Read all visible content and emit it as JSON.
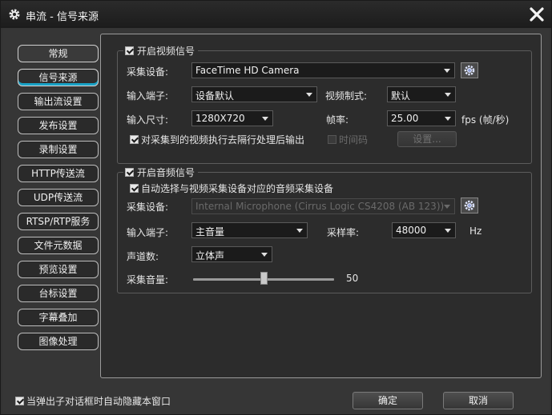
{
  "window": {
    "title": "串流 - 信号来源"
  },
  "nav": {
    "items": [
      {
        "label": "常规"
      },
      {
        "label": "信号来源"
      },
      {
        "label": "输出流设置"
      },
      {
        "label": "发布设置"
      },
      {
        "label": "录制设置"
      },
      {
        "label": "HTTP传送流"
      },
      {
        "label": "UDP传送流"
      },
      {
        "label": "RTSP/RTP服务"
      },
      {
        "label": "文件元数据"
      },
      {
        "label": "预览设置"
      },
      {
        "label": "台标设置"
      },
      {
        "label": "字幕叠加"
      },
      {
        "label": "图像处理"
      }
    ]
  },
  "video": {
    "enable_label": "开启视频信号",
    "device_label": "采集设备:",
    "device_value": "FaceTime HD Camera",
    "input_label": "输入端子:",
    "input_value": "设备默认",
    "standard_label": "视频制式:",
    "standard_value": "默认",
    "size_label": "输入尺寸:",
    "size_value": "1280X720",
    "framerate_label": "帧率:",
    "framerate_value": "25.00",
    "fps_unit": "fps (帧/秒)",
    "deinterlace_label": "对采集到的视频执行去隔行处理后输出",
    "timecode_label": "时间码",
    "settings_button": "设置..."
  },
  "audio": {
    "enable_label": "开启音频信号",
    "auto_select_label": "自动选择与视频采集设备对应的音频采集设备",
    "device_label": "采集设备:",
    "device_value": "Internal Microphone (Cirrus Logic CS4208 (AB 123))",
    "input_label": "输入端子:",
    "input_value": "主音量",
    "samplerate_label": "采样率:",
    "samplerate_value": "48000",
    "samplerate_unit": "Hz",
    "channels_label": "声道数:",
    "channels_value": "立体声",
    "volume_label": "采集音量:",
    "volume_value": "50",
    "volume_level": 0.5
  },
  "footer": {
    "autohide_label": "当弹出子对话框时自动隐藏本窗口",
    "ok_button": "确定",
    "cancel_button": "取消"
  }
}
